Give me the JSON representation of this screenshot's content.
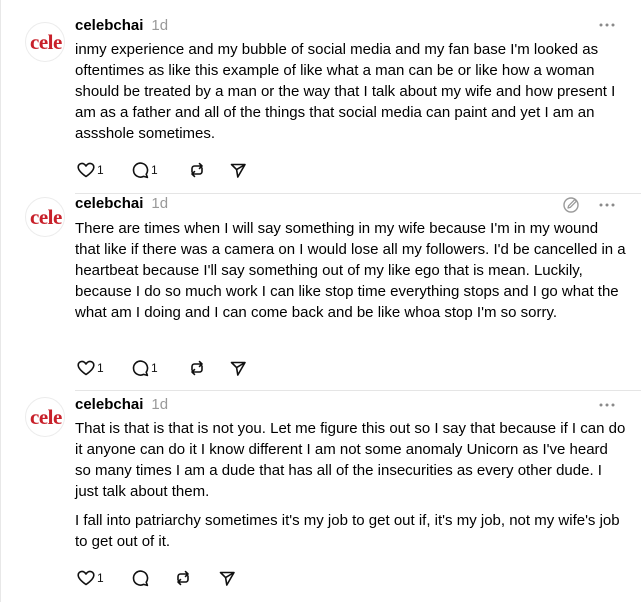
{
  "posts": [
    {
      "avatar_text": "cele",
      "username": "celebchai",
      "time": "1d",
      "paragraphs": [
        "inmy experience and my bubble of social media and my fan base I'm looked as oftentimes as like this example of like what a man can be or like how a woman should be treated by a man or the way that I talk about my wife and how present I am as a father and all of the things that social media can paint and yet I am an assshole sometimes."
      ],
      "likes": "1",
      "replies": "1",
      "more_icon": "more-horizontal-icon"
    },
    {
      "avatar_text": "cele",
      "username": "celebchai",
      "time": "1d",
      "paragraphs": [
        "There are times when I will say something in my wife because I'm in my wound that like if there was a camera on I would lose all my followers. I'd be cancelled in a heartbeat because I'll say something out of my like ego that is mean. Luckily, because I do so much work I can like stop time everything stops and I go what the what am I doing and I can come back and be like whoa stop I'm so sorry."
      ],
      "likes": "1",
      "replies": "1",
      "edit_icon": "edit-icon"
    },
    {
      "avatar_text": "cele",
      "username": "celebchai",
      "time": "1d",
      "paragraphs": [
        "That is that is that is not you. Let me figure this out so I say that because if I can do it anyone can do it I know different I am not some anomaly Unicorn as I've heard so many times I am a dude that has all of the insecurities as every other dude. I just talk about them.",
        "I fall  into patriarchy sometimes it's my job to  get out if, it's my job, not my wife's job to get out of it."
      ],
      "likes": "1",
      "replies": ""
    }
  ],
  "icons": {
    "like": "heart-icon",
    "reply": "comment-icon",
    "repost": "repost-icon",
    "share": "send-icon"
  }
}
